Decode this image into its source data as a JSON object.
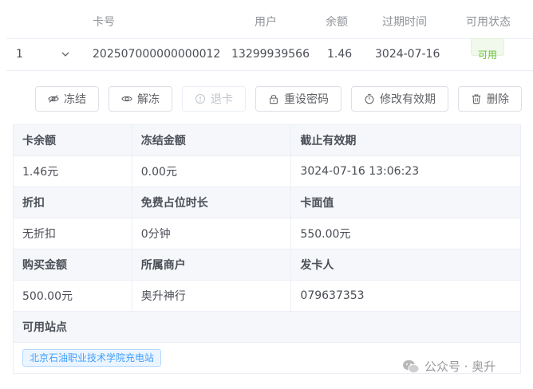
{
  "table": {
    "headers": {
      "card_no": "卡号",
      "user": "用户",
      "balance": "余额",
      "expire": "过期时间",
      "status": "可用状态"
    },
    "row": {
      "index": "1",
      "card_no": "202507000000000012",
      "user": "13299939566",
      "balance": "1.46",
      "expire": "3024-07-16",
      "status": "可用"
    }
  },
  "actions": {
    "freeze": "冻结",
    "unfreeze": "解冻",
    "refund": "退卡",
    "reset_password": "重设密码",
    "modify_validity": "修改有效期",
    "delete": "删除"
  },
  "details": {
    "card_balance_label": "卡余额",
    "card_balance": "1.46元",
    "frozen_amount_label": "冻结金额",
    "frozen_amount": "0.00元",
    "valid_until_label": "截止有效期",
    "valid_until": "3024-07-16 13:06:23",
    "discount_label": "折扣",
    "discount": "无折扣",
    "free_parking_label": "免费占位时长",
    "free_parking": "0分钟",
    "face_value_label": "卡面值",
    "face_value": "550.00元",
    "purchase_amount_label": "购买金额",
    "purchase_amount": "500.00元",
    "merchant_label": "所属商户",
    "merchant": "奥升神行",
    "issuer_label": "发卡人",
    "issuer": "079637353",
    "stations_label": "可用站点",
    "stations": [
      "北京石油职业技术学院充电站"
    ]
  },
  "watermark": "公众号 · 奥升",
  "colors": {
    "status_green": "#67c23a",
    "tag_blue": "#409eff",
    "border": "#ebeef5",
    "label_bg": "#f5f7fa"
  }
}
